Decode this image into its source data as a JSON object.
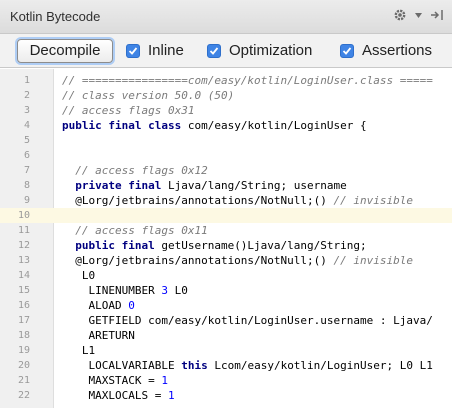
{
  "window": {
    "title": "Kotlin Bytecode",
    "icons": [
      "gear-icon",
      "chevron-down-icon",
      "hide-panel-icon"
    ]
  },
  "toolbar": {
    "decompile_label": "Decompile",
    "checkboxes": [
      {
        "label": "Inline",
        "checked": true
      },
      {
        "label": "Optimization",
        "checked": true
      },
      {
        "label": "Assertions",
        "checked": true
      }
    ]
  },
  "editor": {
    "current_line": 10,
    "lines": [
      {
        "num": "1",
        "tokens": [
          {
            "t": "// ================com/easy/kotlin/LoginUser.class =====",
            "s": "comment"
          }
        ]
      },
      {
        "num": "2",
        "tokens": [
          {
            "t": "// class version 50.0 (50)",
            "s": "comment"
          }
        ]
      },
      {
        "num": "3",
        "tokens": [
          {
            "t": "// access flags 0x31",
            "s": "comment"
          }
        ]
      },
      {
        "num": "4",
        "tokens": [
          {
            "t": "public final class",
            "s": "keyword"
          },
          {
            "t": " com/easy/kotlin/LoginUser {",
            "s": "plain"
          }
        ]
      },
      {
        "num": "5",
        "tokens": []
      },
      {
        "num": "6",
        "tokens": []
      },
      {
        "num": "7",
        "tokens": [
          {
            "t": "  // access flags 0x12",
            "s": "comment"
          }
        ]
      },
      {
        "num": "8",
        "tokens": [
          {
            "t": "  private final",
            "s": "keyword"
          },
          {
            "t": " Ljava/lang/String; username",
            "s": "plain"
          }
        ]
      },
      {
        "num": "9",
        "tokens": [
          {
            "t": "  @Lorg/jetbrains/annotations/NotNull;() ",
            "s": "plain"
          },
          {
            "t": "// invisible",
            "s": "comment"
          }
        ]
      },
      {
        "num": "10",
        "tokens": []
      },
      {
        "num": "11",
        "tokens": [
          {
            "t": "  // access flags 0x11",
            "s": "comment"
          }
        ]
      },
      {
        "num": "12",
        "tokens": [
          {
            "t": "  public final",
            "s": "keyword"
          },
          {
            "t": " getUsername()Ljava/lang/String;",
            "s": "plain"
          }
        ]
      },
      {
        "num": "13",
        "tokens": [
          {
            "t": "  @Lorg/jetbrains/annotations/NotNull;() ",
            "s": "plain"
          },
          {
            "t": "// invisible",
            "s": "comment"
          }
        ]
      },
      {
        "num": "14",
        "tokens": [
          {
            "t": "   L0",
            "s": "plain"
          }
        ]
      },
      {
        "num": "15",
        "tokens": [
          {
            "t": "    LINENUMBER ",
            "s": "plain"
          },
          {
            "t": "3",
            "s": "number"
          },
          {
            "t": " L0",
            "s": "plain"
          }
        ]
      },
      {
        "num": "16",
        "tokens": [
          {
            "t": "    ALOAD ",
            "s": "plain"
          },
          {
            "t": "0",
            "s": "number"
          }
        ]
      },
      {
        "num": "17",
        "tokens": [
          {
            "t": "    GETFIELD com/easy/kotlin/LoginUser.username : Ljava/",
            "s": "plain"
          }
        ]
      },
      {
        "num": "18",
        "tokens": [
          {
            "t": "    ARETURN",
            "s": "plain"
          }
        ]
      },
      {
        "num": "19",
        "tokens": [
          {
            "t": "   L1",
            "s": "plain"
          }
        ]
      },
      {
        "num": "20",
        "tokens": [
          {
            "t": "    LOCALVARIABLE ",
            "s": "plain"
          },
          {
            "t": "this",
            "s": "keyword"
          },
          {
            "t": " Lcom/easy/kotlin/LoginUser; L0 L1",
            "s": "plain"
          }
        ]
      },
      {
        "num": "21",
        "tokens": [
          {
            "t": "    MAXSTACK = ",
            "s": "plain"
          },
          {
            "t": "1",
            "s": "number"
          }
        ]
      },
      {
        "num": "22",
        "tokens": [
          {
            "t": "    MAXLOCALS = ",
            "s": "plain"
          },
          {
            "t": "1",
            "s": "number"
          }
        ]
      }
    ]
  }
}
